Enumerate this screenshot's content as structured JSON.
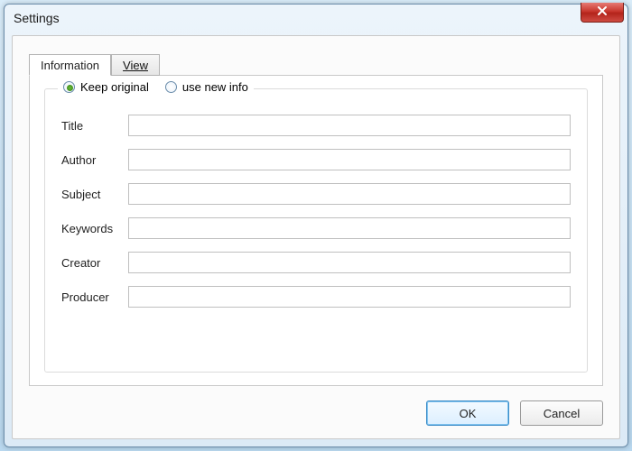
{
  "window": {
    "title": "Settings"
  },
  "tabs": {
    "information": "Information",
    "view": "View"
  },
  "radios": {
    "keep_original": "Keep original",
    "use_new_info": "use new info"
  },
  "fields": {
    "title_label": "Title",
    "author_label": "Author",
    "subject_label": "Subject",
    "keywords_label": "Keywords",
    "creator_label": "Creator",
    "producer_label": "Producer",
    "title_value": "",
    "author_value": "",
    "subject_value": "",
    "keywords_value": "",
    "creator_value": "",
    "producer_value": ""
  },
  "buttons": {
    "ok": "OK",
    "cancel": "Cancel"
  }
}
